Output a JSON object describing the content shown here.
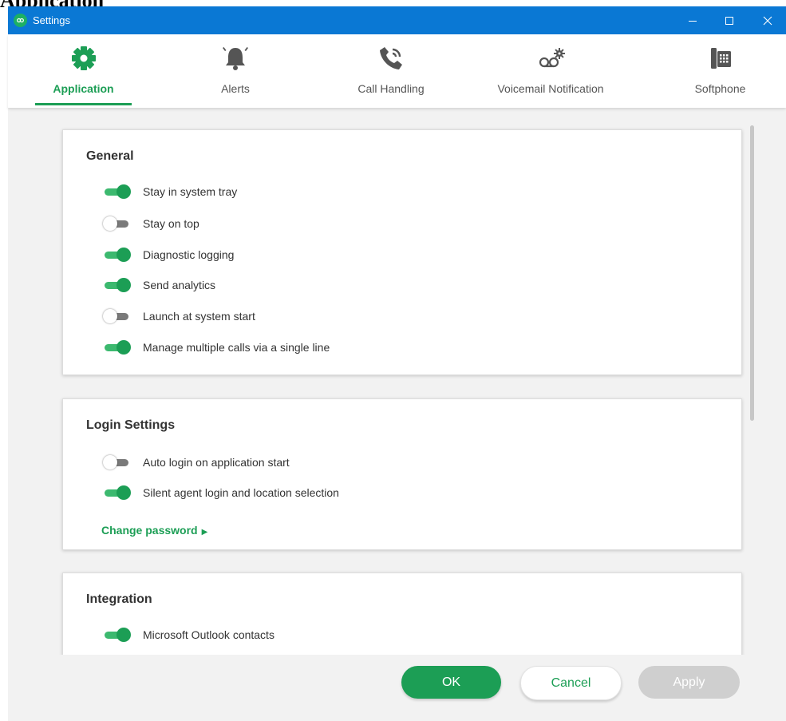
{
  "background_label": "Application",
  "window": {
    "title": "Settings"
  },
  "tabs": [
    {
      "label": "Application",
      "icon": "gear-icon",
      "active": true
    },
    {
      "label": "Alerts",
      "icon": "bell-icon",
      "active": false
    },
    {
      "label": "Call Handling",
      "icon": "phone-icon",
      "active": false
    },
    {
      "label": "Voicemail Notification",
      "icon": "voicemail-icon",
      "active": false
    },
    {
      "label": "Softphone",
      "icon": "desk-phone-icon",
      "active": false
    }
  ],
  "sections": {
    "general": {
      "title": "General",
      "items": [
        {
          "label": "Stay in system tray",
          "on": true
        },
        {
          "label": "Stay on top",
          "on": false
        },
        {
          "label": "Diagnostic logging",
          "on": true
        },
        {
          "label": "Send analytics",
          "on": true
        },
        {
          "label": "Launch at system start",
          "on": false
        },
        {
          "label": "Manage multiple calls via a single line",
          "on": true
        }
      ]
    },
    "login": {
      "title": "Login Settings",
      "items": [
        {
          "label": "Auto login on application start",
          "on": false
        },
        {
          "label": "Silent agent login and location selection",
          "on": true
        }
      ],
      "link": "Change password"
    },
    "integration": {
      "title": "Integration",
      "items": [
        {
          "label": "Microsoft Outlook contacts",
          "on": true
        }
      ]
    }
  },
  "buttons": {
    "ok": "OK",
    "cancel": "Cancel",
    "apply": "Apply"
  },
  "colors": {
    "accent": "#1c9e55",
    "titlebar": "#0a78d4",
    "disabled": "#cfcfcf"
  }
}
